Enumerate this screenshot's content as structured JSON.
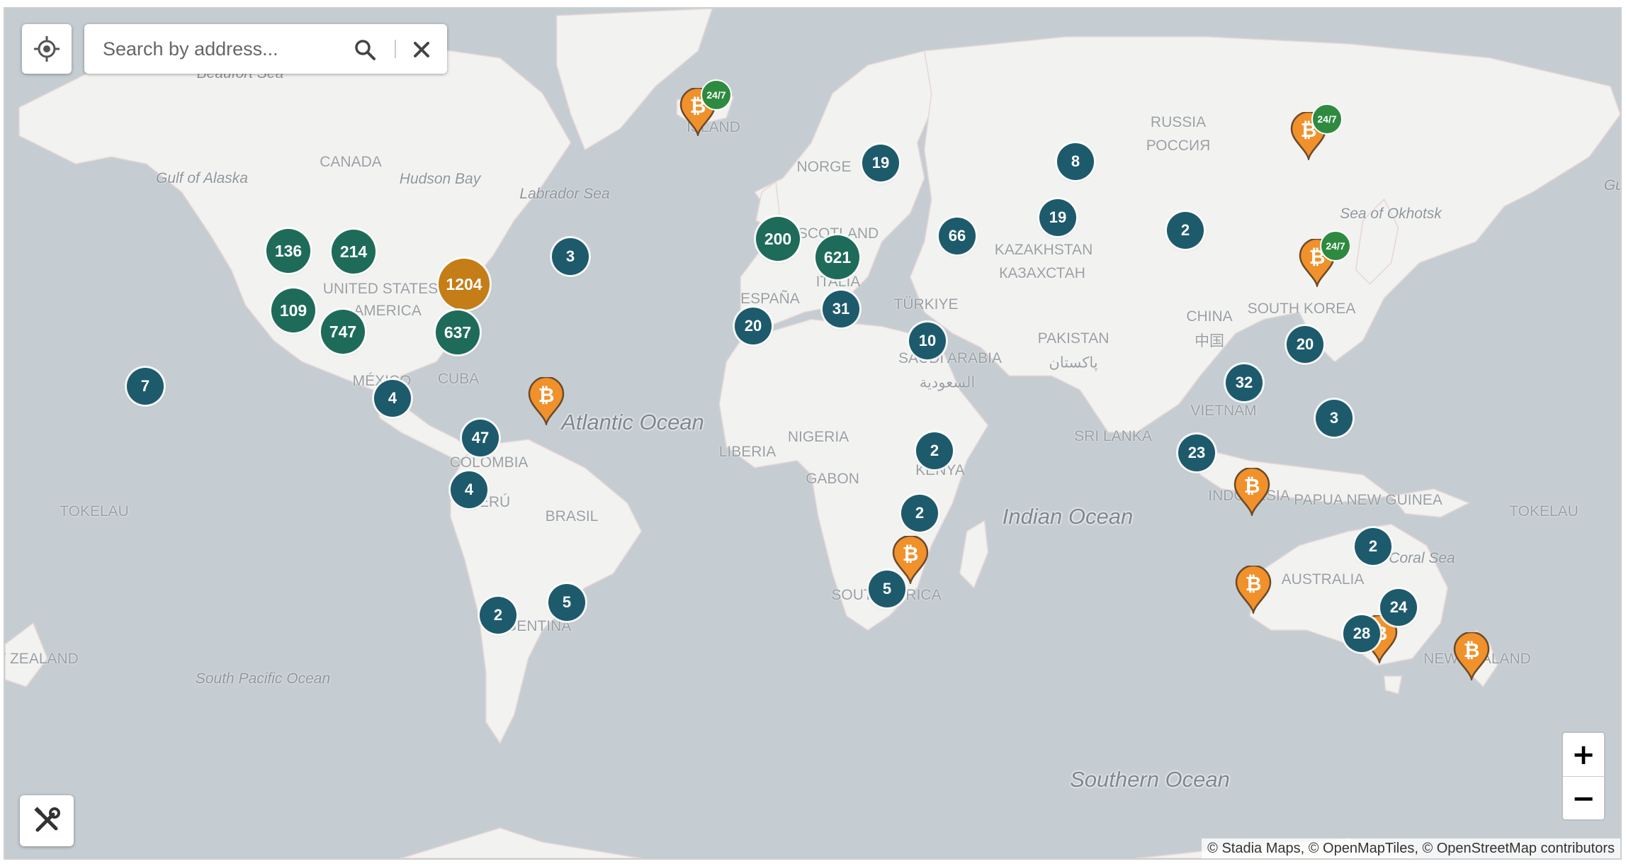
{
  "search": {
    "placeholder": "Search by address..."
  },
  "controls": {
    "locate_icon": "crosshair-icon",
    "search_icon": "magnifier-icon",
    "clear_icon": "close-icon",
    "tools_icon": "tools-icon",
    "zoom_in_label": "+",
    "zoom_out_label": "−"
  },
  "attribution": "© Stadia Maps, © OpenMapTiles, © OpenStreetMap contributors",
  "colors": {
    "cluster_small": "#1d5a6c",
    "cluster_medium": "#1e6b5a",
    "cluster_large": "#c47d17",
    "pin": "#f0912c",
    "badge_24_7": "#2e8a3f",
    "water": "#c5cdd2",
    "land": "#f2f2f0"
  },
  "labels": {
    "beaufort_sea": "Beaufort Sea",
    "gulf_of_alaska": "Gulf of Alaska",
    "canada": "CANADA",
    "hudson_bay": "Hudson Bay",
    "labrador_sea": "Labrador Sea",
    "united_states": "UNITED STATES",
    "america": "AMERICA",
    "mexico": "MÉXICO",
    "cuba": "CUBA",
    "colombia": "COLOMBIA",
    "peru": "PERÚ",
    "brasil": "BRASIL",
    "argentina": "ARGENTINA",
    "tokelau_west": "TOKELAU",
    "tokelau_east": "TOKELAU",
    "nz_west": "NEW ZEALAND",
    "south_pacific_ocean": "South Pacific Ocean",
    "atlantic_ocean": "Atlantic Ocean",
    "iceland": "ÍSLAND",
    "norge": "NORGE",
    "scotland": "SCOTLAND",
    "italia": "ITALIA",
    "espana": "ESPAÑA",
    "turkiye": "TÜRKIYE",
    "saudi_arabia": "SAUDI ARABIA",
    "saudi_arabia_ar": "السعودية",
    "liberia": "LIBERIA",
    "nigeria": "NIGERIA",
    "gabon": "GABON",
    "kenya": "KENYA",
    "south_africa": "SOUTH AFRICA",
    "indian_ocean": "Indian Ocean",
    "russia": "RUSSIA",
    "russia_ru": "РОССИЯ",
    "kazakhstan": "KAZAKHSTAN",
    "kazakhstan_ru": "КАЗАХСТАН",
    "pakistan": "PAKISTAN",
    "pakistan_ur": "پاکستان",
    "china": "CHINA",
    "china_zh": "中国",
    "sri_lanka": "SRI LANKA",
    "vietnam": "VIETNAM",
    "south_korea": "SOUTH KOREA",
    "sea_of_okhotsk": "Sea of Okhotsk",
    "indonesia": "INDONESIA",
    "papua_new_guinea": "PAPUA NEW GUINEA",
    "australia": "AUSTRALIA",
    "coral_sea": "Coral Sea",
    "nz_east": "NEW ZEALAND",
    "southern_ocean": "Southern Ocean",
    "gulf_east": "Gulf"
  },
  "clusters": [
    {
      "id": "c136",
      "count": "136",
      "size": "medium"
    },
    {
      "id": "c214",
      "count": "214",
      "size": "medium"
    },
    {
      "id": "c1204",
      "count": "1204",
      "size": "large"
    },
    {
      "id": "c3a",
      "count": "3",
      "size": "small"
    },
    {
      "id": "c109",
      "count": "109",
      "size": "medium"
    },
    {
      "id": "c747",
      "count": "747",
      "size": "medium"
    },
    {
      "id": "c637",
      "count": "637",
      "size": "medium"
    },
    {
      "id": "c7",
      "count": "7",
      "size": "small"
    },
    {
      "id": "c4a",
      "count": "4",
      "size": "small"
    },
    {
      "id": "c47",
      "count": "47",
      "size": "small"
    },
    {
      "id": "c4b",
      "count": "4",
      "size": "small"
    },
    {
      "id": "c5a",
      "count": "5",
      "size": "small"
    },
    {
      "id": "c2a",
      "count": "2",
      "size": "small"
    },
    {
      "id": "c19a",
      "count": "19",
      "size": "small"
    },
    {
      "id": "c200",
      "count": "200",
      "size": "medium"
    },
    {
      "id": "c621",
      "count": "621",
      "size": "medium"
    },
    {
      "id": "c20a",
      "count": "20",
      "size": "small"
    },
    {
      "id": "c31",
      "count": "31",
      "size": "small"
    },
    {
      "id": "c66",
      "count": "66",
      "size": "small"
    },
    {
      "id": "c10",
      "count": "10",
      "size": "small"
    },
    {
      "id": "c8",
      "count": "8",
      "size": "small"
    },
    {
      "id": "c19b",
      "count": "19",
      "size": "small"
    },
    {
      "id": "c2b",
      "count": "2",
      "size": "small"
    },
    {
      "id": "c2c",
      "count": "2",
      "size": "small"
    },
    {
      "id": "c2d",
      "count": "2",
      "size": "small"
    },
    {
      "id": "c5b",
      "count": "5",
      "size": "small"
    },
    {
      "id": "c20b",
      "count": "20",
      "size": "small"
    },
    {
      "id": "c32",
      "count": "32",
      "size": "small"
    },
    {
      "id": "c3b",
      "count": "3",
      "size": "small"
    },
    {
      "id": "c23",
      "count": "23",
      "size": "small"
    },
    {
      "id": "c2e",
      "count": "2",
      "size": "small"
    },
    {
      "id": "c24",
      "count": "24",
      "size": "small"
    },
    {
      "id": "c28",
      "count": "28",
      "size": "small"
    }
  ],
  "pins": [
    {
      "id": "p-iceland",
      "badge": "24/7"
    },
    {
      "id": "p-russia",
      "badge": "24/7"
    },
    {
      "id": "p-far-east",
      "badge": "24/7"
    },
    {
      "id": "p-caribbean",
      "badge": ""
    },
    {
      "id": "p-indonesia",
      "badge": ""
    },
    {
      "id": "p-mozambique",
      "badge": ""
    },
    {
      "id": "p-west-australia",
      "badge": ""
    },
    {
      "id": "p-sydney",
      "badge": ""
    },
    {
      "id": "p-new-zealand",
      "badge": ""
    }
  ]
}
